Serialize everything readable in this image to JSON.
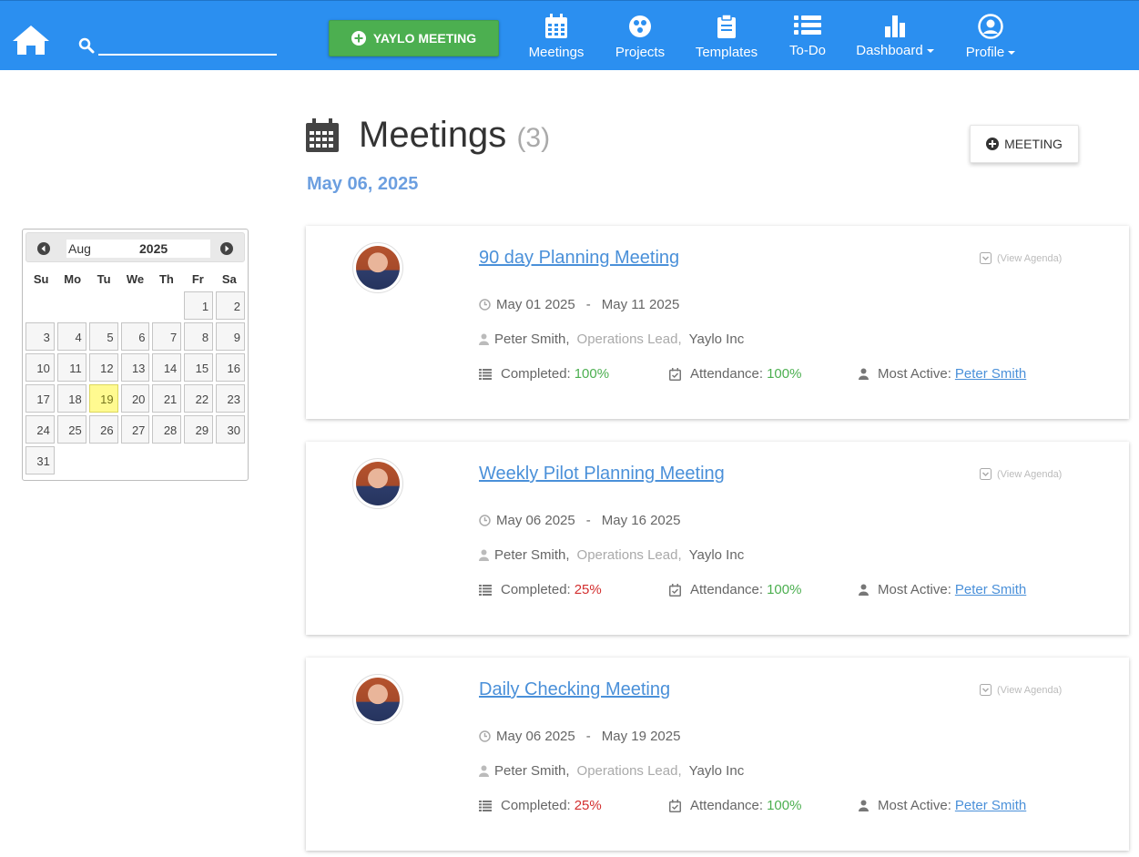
{
  "nav": {
    "search_placeholder": "",
    "yaylo_button": "YAYLO MEETING",
    "items": [
      {
        "label": "Meetings",
        "icon": "calendar-icon"
      },
      {
        "label": "Projects",
        "icon": "projects-icon"
      },
      {
        "label": "Templates",
        "icon": "clipboard-icon"
      },
      {
        "label": "To-Do",
        "icon": "list-icon"
      },
      {
        "label": "Dashboard",
        "icon": "bar-chart-icon",
        "dropdown": true
      },
      {
        "label": "Profile",
        "icon": "user-circle-icon",
        "dropdown": true
      }
    ],
    "accent": "#2b8ff0"
  },
  "header": {
    "title": "Meetings",
    "count": "(3)",
    "date": "May 06, 2025",
    "add_button": "MEETING"
  },
  "calendar": {
    "month": "Aug",
    "year": "2025",
    "weekdays": [
      "Su",
      "Mo",
      "Tu",
      "We",
      "Th",
      "Fr",
      "Sa"
    ],
    "leading_blanks": 5,
    "days": [
      "1",
      "2",
      "3",
      "4",
      "5",
      "6",
      "7",
      "8",
      "9",
      "10",
      "11",
      "12",
      "13",
      "14",
      "15",
      "16",
      "17",
      "18",
      "19",
      "20",
      "21",
      "22",
      "23",
      "24",
      "25",
      "26",
      "27",
      "28",
      "29",
      "30",
      "31"
    ],
    "today": "19"
  },
  "meetings": [
    {
      "title": "90 day Planning Meeting",
      "view_agenda": "(View Agenda)",
      "start": "May 01 2025",
      "separator": "-",
      "end": "May 11 2025",
      "owner": "Peter Smith,",
      "role": "Operations Lead,",
      "company": "Yaylo Inc",
      "completed_label": "Completed:",
      "completed": "100%",
      "completed_status": "good",
      "attendance_label": "Attendance:",
      "attendance": "100%",
      "most_active_label": "Most Active:",
      "most_active": "Peter Smith"
    },
    {
      "title": "Weekly Pilot Planning Meeting",
      "view_agenda": "(View Agenda)",
      "start": "May 06 2025",
      "separator": "-",
      "end": "May 16 2025",
      "owner": "Peter Smith,",
      "role": "Operations Lead,",
      "company": "Yaylo Inc",
      "completed_label": "Completed:",
      "completed": "25%",
      "completed_status": "bad",
      "attendance_label": "Attendance:",
      "attendance": "100%",
      "most_active_label": "Most Active:",
      "most_active": "Peter Smith"
    },
    {
      "title": "Daily Checking Meeting",
      "view_agenda": "(View Agenda)",
      "start": "May 06 2025",
      "separator": "-",
      "end": "May 19 2025",
      "owner": "Peter Smith,",
      "role": "Operations Lead,",
      "company": "Yaylo Inc",
      "completed_label": "Completed:",
      "completed": "25%",
      "completed_status": "bad",
      "attendance_label": "Attendance:",
      "attendance": "100%",
      "most_active_label": "Most Active:",
      "most_active": "Peter Smith"
    }
  ]
}
